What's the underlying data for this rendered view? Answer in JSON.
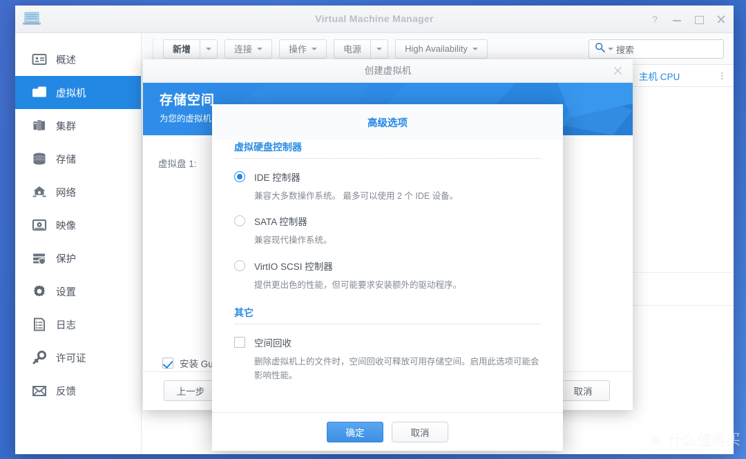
{
  "window": {
    "title": "Virtual Machine Manager",
    "logo_icon": "synology-nas-icon",
    "controls": [
      {
        "name": "help-button",
        "glyph": "?"
      },
      {
        "name": "minimize-button",
        "glyph": ""
      },
      {
        "name": "maximize-button",
        "glyph": ""
      },
      {
        "name": "close-button",
        "glyph": ""
      }
    ]
  },
  "sidebar": {
    "items": [
      {
        "label": "概述",
        "icon": "overview-icon",
        "active": false
      },
      {
        "label": "虚拟机",
        "icon": "virtual-machine-icon",
        "active": true
      },
      {
        "label": "集群",
        "icon": "cluster-icon",
        "active": false
      },
      {
        "label": "存储",
        "icon": "storage-icon",
        "active": false
      },
      {
        "label": "网络",
        "icon": "network-icon",
        "active": false
      },
      {
        "label": "映像",
        "icon": "image-icon",
        "active": false
      },
      {
        "label": "保护",
        "icon": "protection-icon",
        "active": false
      },
      {
        "label": "设置",
        "icon": "settings-gear-icon",
        "active": false
      },
      {
        "label": "日志",
        "icon": "log-icon",
        "active": false
      },
      {
        "label": "许可证",
        "icon": "license-key-icon",
        "active": false
      },
      {
        "label": "反馈",
        "icon": "feedback-mail-icon",
        "active": false
      }
    ]
  },
  "toolbar": {
    "buttons": [
      {
        "label": "新增",
        "has_split_caret": true,
        "has_caret": false
      },
      {
        "label": "连接",
        "has_split_caret": false,
        "has_caret": true
      },
      {
        "label": "操作",
        "has_split_caret": false,
        "has_caret": true
      },
      {
        "label": "电源",
        "has_split_caret": true,
        "has_caret": false
      },
      {
        "label": "High Availability",
        "has_split_caret": false,
        "has_caret": true
      }
    ],
    "search": {
      "placeholder": "搜索",
      "icon": "search-icon"
    }
  },
  "metric_panel": {
    "title": "主机 CPU",
    "menu_icon": "vertical-dots-icon"
  },
  "wizard": {
    "title": "创建虚拟机",
    "close_icon": "close-icon",
    "banner": {
      "heading": "存储空间",
      "subheading": "为您的虚拟机"
    },
    "disk_label": "虚拟盘 1:",
    "guest_checkbox": {
      "label": "安装 Gue",
      "checked": true
    },
    "buttons": {
      "prev": "上一步",
      "cancel": "取消"
    }
  },
  "advanced": {
    "title": "高级选项",
    "sections": [
      {
        "heading": "虚拟硬盘控制器",
        "options": [
          {
            "label": "IDE 控制器",
            "selected": true,
            "description": "兼容大多数操作系统。 最多可以使用 2 个 IDE 设备。"
          },
          {
            "label": "SATA 控制器",
            "selected": false,
            "description": "兼容现代操作系统。"
          },
          {
            "label": "VirtIO SCSI 控制器",
            "selected": false,
            "description": "提供更出色的性能，但可能要求安装额外的驱动程序。"
          }
        ]
      },
      {
        "heading": "其它",
        "checkbox": {
          "label": "空间回收",
          "checked": false,
          "description": "删除虚拟机上的文件时，空间回收可释放可用存储空间。启用此选项可能会影响性能。"
        }
      }
    ],
    "buttons": {
      "ok": "确定",
      "cancel": "取消"
    }
  },
  "watermark": {
    "mark": "值",
    "text": "什么值得买"
  },
  "colors": {
    "accent": "#2288e4",
    "sidebar_active": "#2288e4",
    "banner": "#2e8ce8",
    "desktop": "#3c76dd",
    "text": "#4c545e"
  }
}
